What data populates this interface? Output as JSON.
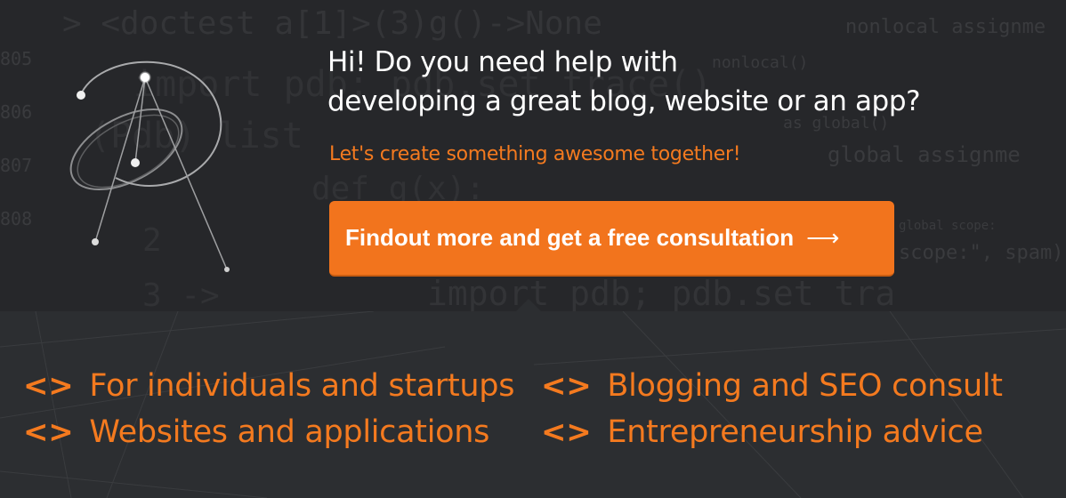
{
  "hero": {
    "headline_line1": "Hi! Do you need help with",
    "headline_line2": "developing a great blog, website or an app?",
    "subheading": "Let's create something awesome together!",
    "cta_label": "Findout more and get a free consultation",
    "cta_arrow": "⟶"
  },
  "code_lines": [
    "> <doctest a[1]>(3)g()->None",
    "805",
    "import pdb; pdb.set_trace()",
    "806",
    "(Pdb) list",
    "807",
    "def g(x):",
    "808",
    "2",
    "3 ->",
    "import pdb; pdb.set_tra",
    "nonlocal assignme",
    "global assignme",
    "nonlocal()",
    "as global()",
    "scope:\", spam)",
    "global scope:"
  ],
  "features": [
    {
      "bracket": "<>",
      "label": "For individuals and startups"
    },
    {
      "bracket": "<>",
      "label": "Websites and applications"
    },
    {
      "bracket": "<>",
      "label": "Blogging and SEO consult"
    },
    {
      "bracket": "<>",
      "label": "Entrepreneurship advice"
    }
  ],
  "colors": {
    "accent": "#f2741d",
    "background_top": "#26272a",
    "background_bottom": "#2c2e31",
    "headline": "#ffffff"
  },
  "icons": {
    "cta_arrow": "long-arrow-right-icon",
    "logo": "orbital-a-logo-icon",
    "feature_bullet": "code-brackets-icon"
  }
}
